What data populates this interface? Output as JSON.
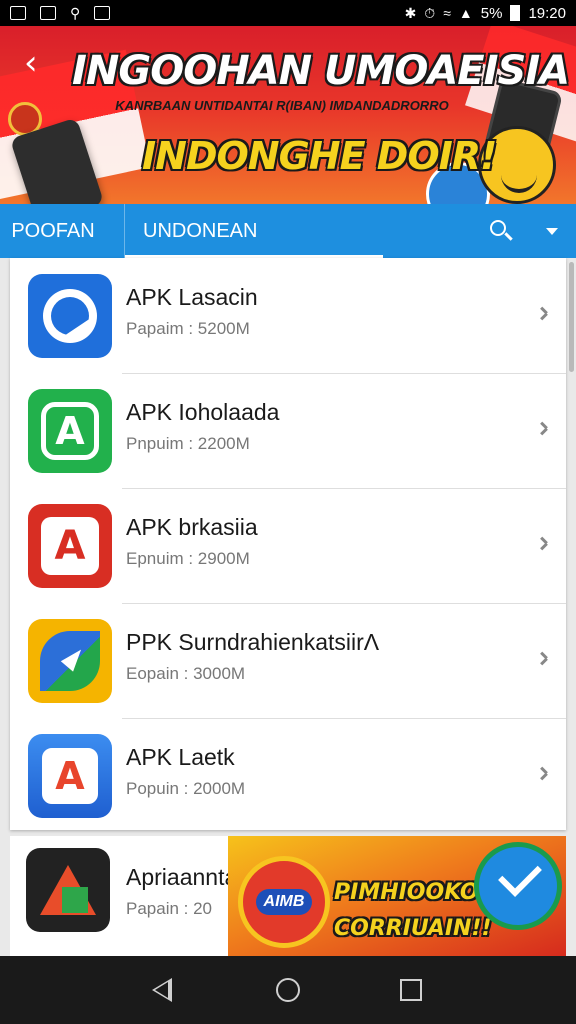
{
  "status_bar": {
    "battery_text": "5%",
    "time": "19:20"
  },
  "banner": {
    "title": "INGOOHAN UMOAEISIA",
    "subtitle": "KANRBAAN UNTIDANTAI R(IBAN) IMDANDADRORRO",
    "cta": "INDONGHE DOIR!"
  },
  "tabs": {
    "first": "POOFAN",
    "active": "UNDONEAN"
  },
  "apps": [
    {
      "name": "APK Lasacin",
      "size": "Papaim : 5200M",
      "icon": "blue-circle-icon"
    },
    {
      "name": "APK Ioholaada",
      "size": "Pnpuim : 2200M",
      "icon": "green-a-icon"
    },
    {
      "name": "APK brkasiia",
      "size": "Epnuim : 2900M",
      "icon": "red-a-icon"
    },
    {
      "name": "PPK SurndrahienkatsiirɅ",
      "size": "Eopain : 3000M",
      "icon": "compass-leaf-icon"
    },
    {
      "name": "APK Laetk",
      "size": "Popuin : 2000M",
      "icon": "blue-a-icon"
    }
  ],
  "ad": {
    "name": "Apriaannta",
    "size": "Papain : 20",
    "badge": "AIMB",
    "promo_line1": "PIMHIOOKON",
    "promo_line2": "CORRIUAIN!!"
  },
  "colors": {
    "tab_bar": "#1e8fdf",
    "banner_red": "#d91f2a",
    "banner_yellow": "#f5d21e"
  }
}
